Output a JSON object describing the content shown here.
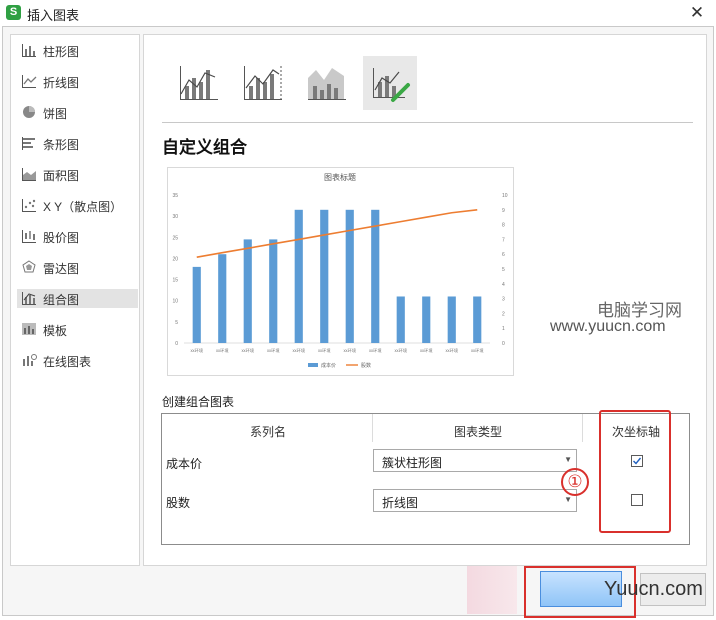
{
  "window": {
    "title": "插入图表",
    "logo": "S",
    "close_glyph": "✕"
  },
  "sidebar": {
    "items": [
      {
        "label": "柱形图",
        "icon": "column-chart-icon"
      },
      {
        "label": "折线图",
        "icon": "line-chart-icon"
      },
      {
        "label": "饼图",
        "icon": "pie-chart-icon"
      },
      {
        "label": "条形图",
        "icon": "bar-chart-icon"
      },
      {
        "label": "面积图",
        "icon": "area-chart-icon"
      },
      {
        "label": "X Y（散点图）",
        "icon": "scatter-chart-icon"
      },
      {
        "label": "股价图",
        "icon": "stock-chart-icon"
      },
      {
        "label": "雷达图",
        "icon": "radar-chart-icon"
      },
      {
        "label": "组合图",
        "icon": "combo-chart-icon",
        "selected": true
      },
      {
        "label": "模板",
        "icon": "template-icon"
      },
      {
        "label": "在线图表",
        "icon": "online-chart-icon"
      }
    ]
  },
  "subtypes": [
    "combo-column-line-icon",
    "combo-column-line-secondary-axis-icon",
    "combo-area-column-icon",
    "custom-combo-icon"
  ],
  "section_title": "自定义组合",
  "preview": {
    "chart_data": {
      "type": "bar",
      "title": "图表标题",
      "categories": [
        "xx环境",
        "xx环境",
        "xx环境",
        "xx环境",
        "xx环境",
        "xx环境",
        "xx环境",
        "xx环境",
        "xx环境",
        "xx环境",
        "xx环境",
        "xx环境"
      ],
      "series": [
        {
          "name": "成本价",
          "type": "bar",
          "axis": "primary",
          "values": [
            18,
            21,
            24.5,
            24.5,
            31.5,
            31.5,
            31.5,
            31.5,
            11,
            11,
            11,
            11
          ]
        },
        {
          "name": "股数",
          "type": "line",
          "axis": "secondary",
          "values": [
            5.8,
            6.1,
            6.4,
            6.7,
            7.0,
            7.3,
            7.6,
            7.9,
            8.2,
            8.5,
            8.8,
            9.0
          ]
        }
      ],
      "ylim": [
        0,
        35
      ],
      "yticks": [
        "35",
        "30",
        "25",
        "20",
        "15",
        "10",
        "5",
        "0"
      ],
      "y2lim": [
        0,
        10
      ],
      "y2ticks": [
        "10",
        "9",
        "8",
        "7",
        "6",
        "5",
        "4",
        "3",
        "2",
        "1",
        "0"
      ],
      "legend_position": "bottom",
      "bar_color": "#5b9bd5",
      "line_color": "#ed7d31",
      "grid": false
    }
  },
  "combo": {
    "label": "创建组合图表",
    "headers": {
      "series": "系列名",
      "type": "图表类型",
      "secondary": "次坐标轴"
    },
    "rows": [
      {
        "name": "成本价",
        "type": "簇状柱形图",
        "secondary_axis": true
      },
      {
        "name": "股数",
        "type": "折线图",
        "secondary_axis": false
      }
    ]
  },
  "annotations": {
    "marker_1": "①"
  },
  "watermark": {
    "line1": "电脑学习网",
    "line2": "www.yuucn.com",
    "corner": "Yuucn.com"
  },
  "colors": {
    "highlight_red": "#d9302c",
    "ok_blue": "#8fc4f7"
  }
}
